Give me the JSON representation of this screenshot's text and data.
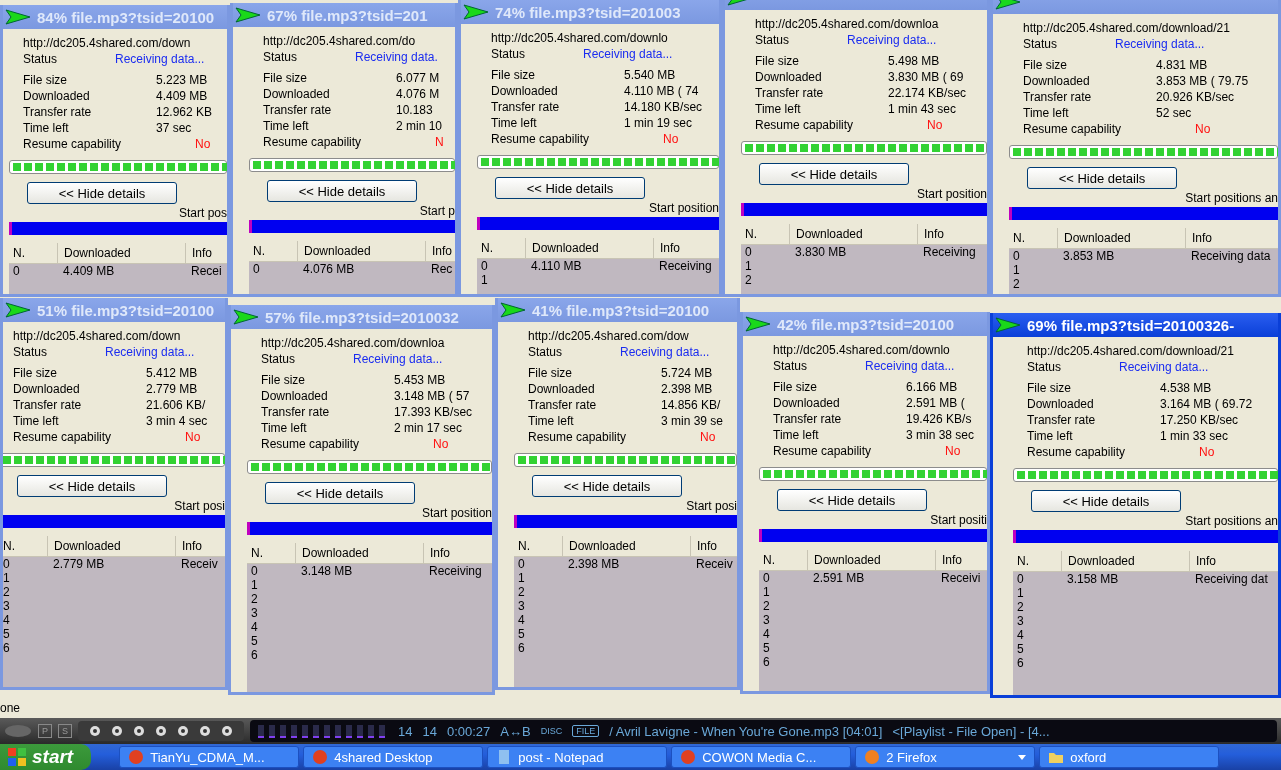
{
  "windows": [
    {
      "active": false,
      "title": "84% file.mp3?tsid=20100",
      "url": "http://dc205.4shared.com/down",
      "status_label": "Status",
      "status": "Receiving data...",
      "fields": [
        {
          "label": "File size",
          "value": "5.223 MB"
        },
        {
          "label": "Downloaded",
          "value": "4.409 MB"
        },
        {
          "label": "Transfer rate",
          "value": "12.962 KB"
        },
        {
          "label": "Time left",
          "value": "37 sec"
        }
      ],
      "resume": {
        "label": "Resume capability",
        "value": "No"
      },
      "button": "<< Hide details",
      "caption": "Start pos",
      "columns": [
        "N.",
        "Downloaded",
        "Info"
      ],
      "rows": [
        [
          "0",
          "4.409 MB",
          "Recei"
        ]
      ]
    },
    {
      "active": false,
      "title": "67% file.mp3?tsid=201",
      "url": "http://dc205.4shared.com/do",
      "status_label": "Status",
      "status": "Receiving data.",
      "fields": [
        {
          "label": "File size",
          "value": "6.077 M"
        },
        {
          "label": "Downloaded",
          "value": "4.076 M"
        },
        {
          "label": "Transfer rate",
          "value": "10.183"
        },
        {
          "label": "Time left",
          "value": "2 min 10"
        }
      ],
      "resume": {
        "label": "Resume capability",
        "value": "N"
      },
      "button": "<< Hide details",
      "caption": "Start p",
      "columns": [
        "N.",
        "Downloaded",
        "Info"
      ],
      "rows": [
        [
          "0",
          "4.076 MB",
          "Rec"
        ]
      ]
    },
    {
      "active": false,
      "title": "74% file.mp3?tsid=201003",
      "url": "http://dc205.4shared.com/downlo",
      "status_label": "Status",
      "status": "Receiving data...",
      "fields": [
        {
          "label": "File size",
          "value": "5.540 MB"
        },
        {
          "label": "Downloaded",
          "value": "4.110 MB ( 74"
        },
        {
          "label": "Transfer rate",
          "value": "14.180 KB/sec"
        },
        {
          "label": "Time left",
          "value": "1 min 19 sec"
        }
      ],
      "resume": {
        "label": "Resume capability",
        "value": "No"
      },
      "button": "<< Hide details",
      "caption": "Start position",
      "columns": [
        "N.",
        "Downloaded",
        "Info"
      ],
      "rows": [
        [
          "0",
          "4.110 MB",
          "Receiving"
        ],
        [
          "1"
        ]
      ]
    },
    {
      "active": false,
      "url": "http://dc205.4shared.com/downloa",
      "status_label": "Status",
      "status": "Receiving data...",
      "fields": [
        {
          "label": "File size",
          "value": "5.498 MB"
        },
        {
          "label": "Downloaded",
          "value": "3.830 MB ( 69"
        },
        {
          "label": "Transfer rate",
          "value": "22.174 KB/sec"
        },
        {
          "label": "Time left",
          "value": "1 min 43 sec"
        }
      ],
      "resume": {
        "label": "Resume capability",
        "value": "No"
      },
      "button": "<< Hide details",
      "caption": "Start position",
      "columns": [
        "N.",
        "Downloaded",
        "Info"
      ],
      "rows": [
        [
          "0",
          "3.830 MB",
          "Receiving"
        ],
        [
          "1"
        ],
        [
          "2"
        ]
      ]
    },
    {
      "active": false,
      "url": "http://dc205.4shared.com/download/21",
      "status_label": "Status",
      "status": "Receiving data...",
      "fields": [
        {
          "label": "File size",
          "value": "4.831 MB"
        },
        {
          "label": "Downloaded",
          "value": "3.853 MB ( 79.75"
        },
        {
          "label": "Transfer rate",
          "value": "20.926 KB/sec"
        },
        {
          "label": "Time left",
          "value": "52 sec"
        }
      ],
      "resume": {
        "label": "Resume capability",
        "value": "No"
      },
      "button": "<< Hide details",
      "caption": "Start positions an",
      "columns": [
        "N.",
        "Downloaded",
        "Info"
      ],
      "rows": [
        [
          "0",
          "3.853 MB",
          "Receiving data"
        ],
        [
          "1"
        ],
        [
          "2"
        ]
      ]
    },
    {
      "active": false,
      "title": "51% file.mp3?tsid=20100",
      "url": "http://dc205.4shared.com/down",
      "status_label": "Status",
      "status": "Receiving data...",
      "fields": [
        {
          "label": "File size",
          "value": "5.412 MB"
        },
        {
          "label": "Downloaded",
          "value": "2.779 MB"
        },
        {
          "label": "Transfer rate",
          "value": "21.606 KB/"
        },
        {
          "label": "Time left",
          "value": "3 min 4 sec"
        }
      ],
      "resume": {
        "label": "Resume capability",
        "value": "No"
      },
      "button": "<< Hide details",
      "caption": "Start posi",
      "columns": [
        "N.",
        "Downloaded",
        "Info"
      ],
      "rows": [
        [
          "0",
          "2.779 MB",
          "Receiv"
        ],
        [
          "1"
        ],
        [
          "2"
        ],
        [
          "3"
        ],
        [
          "4"
        ],
        [
          "5"
        ],
        [
          "6"
        ]
      ]
    },
    {
      "active": false,
      "title": "57% file.mp3?tsid=2010032",
      "url": "http://dc205.4shared.com/downloa",
      "status_label": "Status",
      "status": "Receiving data...",
      "fields": [
        {
          "label": "File size",
          "value": "5.453 MB"
        },
        {
          "label": "Downloaded",
          "value": "3.148 MB ( 57"
        },
        {
          "label": "Transfer rate",
          "value": "17.393 KB/sec"
        },
        {
          "label": "Time left",
          "value": "2 min 17 sec"
        }
      ],
      "resume": {
        "label": "Resume capability",
        "value": "No"
      },
      "button": "<< Hide details",
      "caption": "Start position",
      "columns": [
        "N.",
        "Downloaded",
        "Info"
      ],
      "rows": [
        [
          "0",
          "3.148 MB",
          "Receiving"
        ],
        [
          "1"
        ],
        [
          "2"
        ],
        [
          "3"
        ],
        [
          "4"
        ],
        [
          "5"
        ],
        [
          "6"
        ]
      ]
    },
    {
      "active": false,
      "title": "41% file.mp3?tsid=20100",
      "url": "http://dc205.4shared.com/dow",
      "status_label": "Status",
      "status": "Receiving data...",
      "fields": [
        {
          "label": "File size",
          "value": "5.724 MB"
        },
        {
          "label": "Downloaded",
          "value": "2.398 MB"
        },
        {
          "label": "Transfer rate",
          "value": "14.856 KB/"
        },
        {
          "label": "Time left",
          "value": "3 min 39 se"
        }
      ],
      "resume": {
        "label": "Resume capability",
        "value": "No"
      },
      "button": "<< Hide details",
      "caption": "Start posi",
      "columns": [
        "N.",
        "Downloaded",
        "Info"
      ],
      "rows": [
        [
          "0",
          "2.398 MB",
          "Receiv"
        ],
        [
          "1"
        ],
        [
          "2"
        ],
        [
          "3"
        ],
        [
          "4"
        ],
        [
          "5"
        ],
        [
          "6"
        ]
      ]
    },
    {
      "active": false,
      "title": "42% file.mp3?tsid=20100",
      "url": "http://dc205.4shared.com/downlo",
      "status_label": "Status",
      "status": "Receiving data...",
      "fields": [
        {
          "label": "File size",
          "value": "6.166 MB"
        },
        {
          "label": "Downloaded",
          "value": "2.591 MB ("
        },
        {
          "label": "Transfer rate",
          "value": "19.426 KB/s"
        },
        {
          "label": "Time left",
          "value": "3 min 38 sec"
        }
      ],
      "resume": {
        "label": "Resume capability",
        "value": "No"
      },
      "button": "<< Hide details",
      "caption": "Start positi",
      "columns": [
        "N.",
        "Downloaded",
        "Info"
      ],
      "rows": [
        [
          "0",
          "2.591 MB",
          "Receivi"
        ],
        [
          "1"
        ],
        [
          "2"
        ],
        [
          "3"
        ],
        [
          "4"
        ],
        [
          "5"
        ],
        [
          "6"
        ]
      ]
    },
    {
      "active": true,
      "title": "69% file.mp3?tsid=20100326-",
      "url": "http://dc205.4shared.com/download/21",
      "status_label": "Status",
      "status": "Receiving data...",
      "fields": [
        {
          "label": "File size",
          "value": "4.538 MB"
        },
        {
          "label": "Downloaded",
          "value": "3.164 MB ( 69.72"
        },
        {
          "label": "Transfer rate",
          "value": "17.250 KB/sec"
        },
        {
          "label": "Time left",
          "value": "1 min 33 sec"
        }
      ],
      "resume": {
        "label": "Resume capability",
        "value": "No"
      },
      "button": "<< Hide details",
      "caption": "Start positions an",
      "columns": [
        "N.",
        "Downloaded",
        "Info"
      ],
      "rows": [
        [
          "0",
          "3.158 MB",
          "Receiving dat"
        ],
        [
          "1"
        ],
        [
          "2"
        ],
        [
          "3"
        ],
        [
          "4"
        ],
        [
          "5"
        ],
        [
          "6"
        ]
      ]
    }
  ],
  "status_bar": "one",
  "player": {
    "buttons": [
      "P",
      "S"
    ],
    "track": "14",
    "total": "14",
    "time": "0:00:27",
    "ab": "A↔B",
    "disc": "DISC",
    "file": "FILE",
    "song": "/ Avril Lavigne - When You're Gone.mp3  [04:01]",
    "playlist": "<[Playlist - File Open] - [4..."
  },
  "taskbar": {
    "start": "start",
    "items": [
      {
        "label": "TianYu_CDMA_M...",
        "kind": "app"
      },
      {
        "label": "4shared Desktop",
        "kind": "app"
      },
      {
        "label": "post - Notepad",
        "kind": "doc"
      },
      {
        "label": "COWON Media C...",
        "kind": "app"
      },
      {
        "label": "2 Firefox",
        "kind": "group"
      },
      {
        "label": "oxford",
        "kind": "folder"
      }
    ]
  }
}
